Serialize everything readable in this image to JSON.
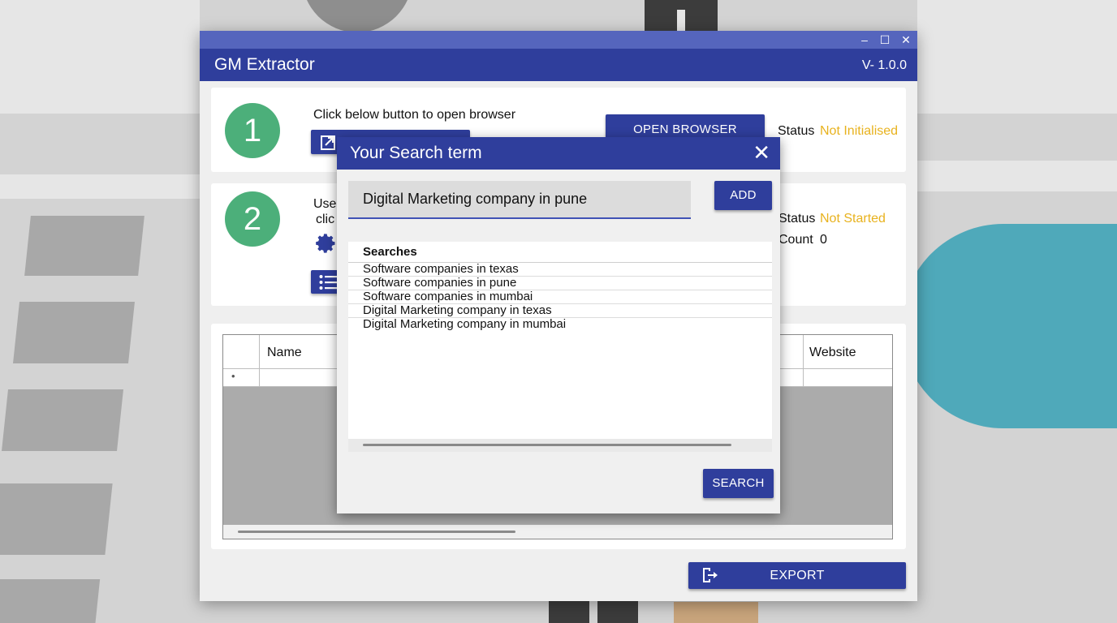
{
  "window": {
    "title": "GM Extractor",
    "version": "V- 1.0.0",
    "controls": {
      "minimize": "–",
      "maximize": "☐",
      "close": "✕"
    }
  },
  "step1": {
    "number": "1",
    "instruction": "Click below button to open browser",
    "open_browser_label": "OPEN BROWSER",
    "status_label": "Status",
    "status_value": "Not Initialised",
    "icon": "external-link-icon"
  },
  "step2": {
    "number": "2",
    "instruction_line1": "Use",
    "instruction_line2": "clic",
    "status_label": "Status",
    "status_value": "Not Started",
    "count_label": "Count",
    "count_value": "0",
    "icons": [
      "gear-icon",
      "list-icon"
    ]
  },
  "table": {
    "columns": [
      "Name",
      "Website"
    ],
    "row_marker": "•"
  },
  "export": {
    "label": "EXPORT",
    "icon": "export-icon"
  },
  "dialog": {
    "title": "Your Search term",
    "close": "✕",
    "input_value": "Digital Marketing company in pune",
    "add_label": "ADD",
    "list_header": "Searches",
    "items": [
      "Software companies in texas",
      "Software companies in pune",
      "Software companies in mumbai",
      "Digital Marketing company in texas",
      "Digital Marketing company in mumbai"
    ],
    "search_label": "SEARCH"
  },
  "colors": {
    "primary": "#2f3e9c",
    "titlebar": "#5565bd",
    "step_circle": "#4caf7a",
    "status_warn": "#e8b21e"
  }
}
